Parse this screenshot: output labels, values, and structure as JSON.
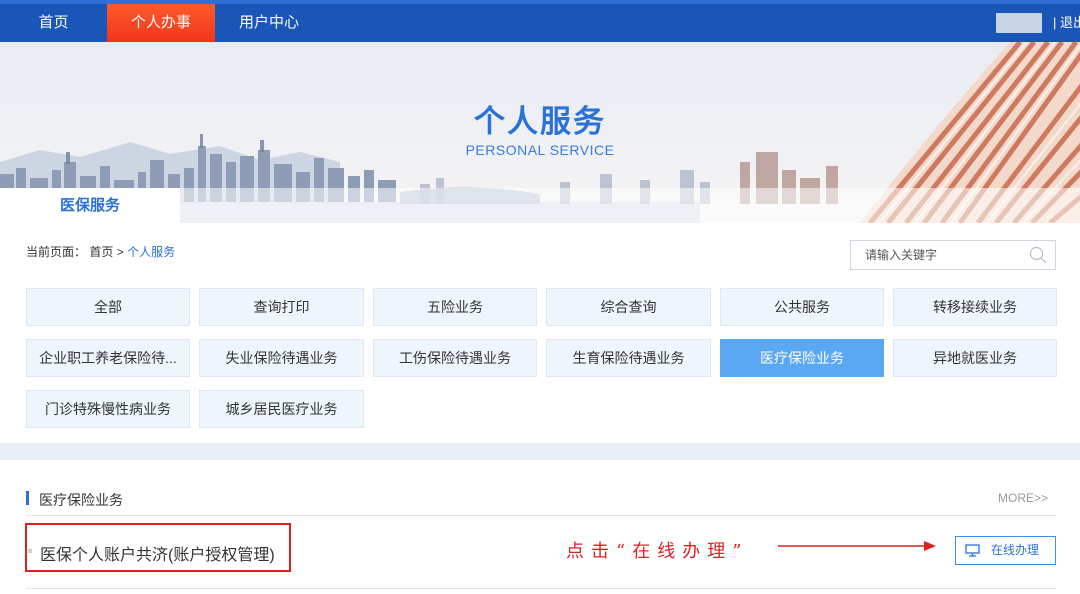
{
  "nav": {
    "items": [
      "首页",
      "个人办事",
      "用户中心"
    ],
    "active_index": 1,
    "logout": "| 退出"
  },
  "banner": {
    "title": "个人服务",
    "subtitle": "PERSONAL SERVICE",
    "tab": "医保服务"
  },
  "breadcrumb": {
    "prefix": "当前页面：",
    "home": "首页",
    "separator": ">",
    "current": "个人服务"
  },
  "search": {
    "placeholder": "请输入关键字",
    "value": ""
  },
  "categories": [
    "全部",
    "查询打印",
    "五险业务",
    "综合查询",
    "公共服务",
    "转移接续业务",
    "企业职工养老保险待...",
    "失业保险待遇业务",
    "工伤保险待遇业务",
    "生育保险待遇业务",
    "医疗保险业务",
    "异地就医业务",
    "门诊特殊慢性病业务",
    "城乡居民医疗业务"
  ],
  "active_category_index": 10,
  "section": {
    "title": "医疗保险业务",
    "more": "MORE>>"
  },
  "items": [
    {
      "title": "医保个人账户共济(账户授权管理)",
      "action_label": "在线办理"
    }
  ],
  "annotation": "点击“在线办理”",
  "colors": {
    "nav_bg": "#1a55b8",
    "nav_active": "#f0361c",
    "accent": "#2a71d8",
    "category_active": "#5aa8f3",
    "highlight_red": "#e02020"
  }
}
